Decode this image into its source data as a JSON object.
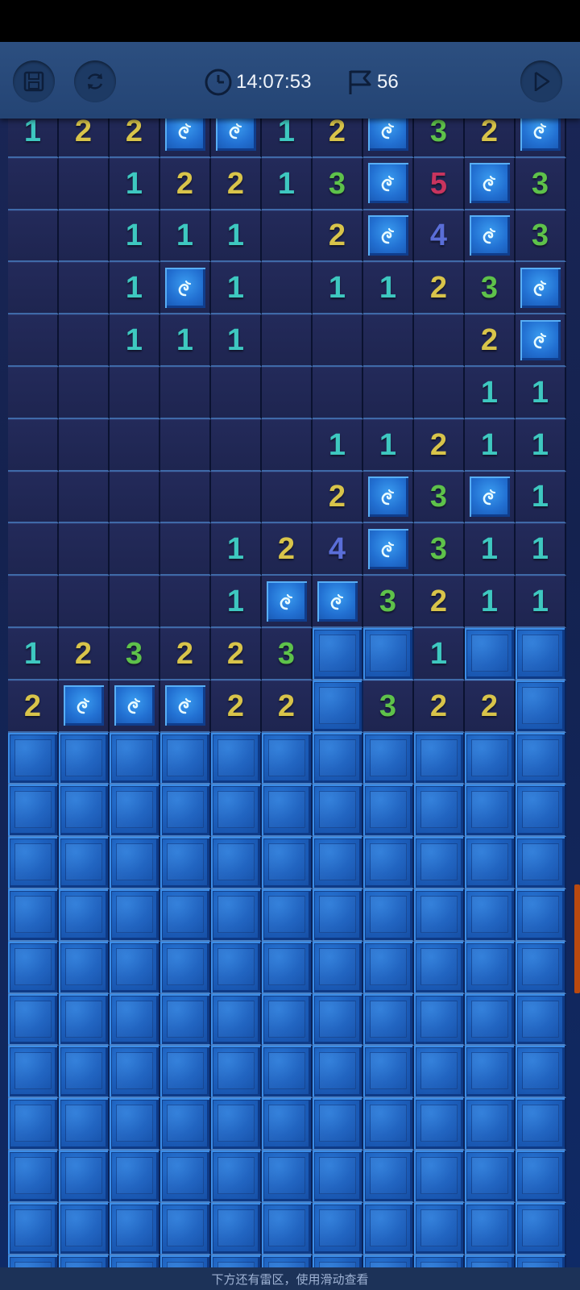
{
  "toolbar": {
    "timer": "14:07:53",
    "flags_remaining": "56"
  },
  "board": {
    "rows": [
      [
        "1",
        "2",
        "2",
        "M",
        "M",
        "1",
        "2",
        "M",
        "3",
        "2",
        "M"
      ],
      [
        "",
        "",
        "1",
        "2",
        "2",
        "1",
        "3",
        "M",
        "5",
        "M",
        "3"
      ],
      [
        "",
        "",
        "1",
        "1",
        "1",
        "",
        "2",
        "M",
        "4",
        "M",
        "3"
      ],
      [
        "",
        "",
        "1",
        "M",
        "1",
        "",
        "1",
        "1",
        "2",
        "3",
        "M"
      ],
      [
        "",
        "",
        "1",
        "1",
        "1",
        "",
        "",
        "",
        "",
        "2",
        "M"
      ],
      [
        "",
        "",
        "",
        "",
        "",
        "",
        "",
        "",
        "",
        "1",
        "1"
      ],
      [
        "",
        "",
        "",
        "",
        "",
        "",
        "1",
        "1",
        "2",
        "1",
        "1"
      ],
      [
        "",
        "",
        "",
        "",
        "",
        "",
        "2",
        "M",
        "3",
        "M",
        "1"
      ],
      [
        "",
        "",
        "",
        "",
        "1",
        "2",
        "4",
        "M",
        "3",
        "1",
        "1"
      ],
      [
        "",
        "",
        "",
        "",
        "1",
        "M",
        "M",
        "3",
        "2",
        "1",
        "1"
      ],
      [
        "1",
        "2",
        "3",
        "2",
        "2",
        "3",
        "C",
        "C",
        "1",
        "C",
        "C"
      ],
      [
        "2",
        "M",
        "M",
        "M",
        "2",
        "2",
        "C",
        "3",
        "2",
        "2",
        "C"
      ],
      [
        "C",
        "C",
        "C",
        "C",
        "C",
        "C",
        "C",
        "C",
        "C",
        "C",
        "C"
      ],
      [
        "C",
        "C",
        "C",
        "C",
        "C",
        "C",
        "C",
        "C",
        "C",
        "C",
        "C"
      ],
      [
        "C",
        "C",
        "C",
        "C",
        "C",
        "C",
        "C",
        "C",
        "C",
        "C",
        "C"
      ],
      [
        "C",
        "C",
        "C",
        "C",
        "C",
        "C",
        "C",
        "C",
        "C",
        "C",
        "C"
      ],
      [
        "C",
        "C",
        "C",
        "C",
        "C",
        "C",
        "C",
        "C",
        "C",
        "C",
        "C"
      ],
      [
        "C",
        "C",
        "C",
        "C",
        "C",
        "C",
        "C",
        "C",
        "C",
        "C",
        "C"
      ],
      [
        "C",
        "C",
        "C",
        "C",
        "C",
        "C",
        "C",
        "C",
        "C",
        "C",
        "C"
      ],
      [
        "C",
        "C",
        "C",
        "C",
        "C",
        "C",
        "C",
        "C",
        "C",
        "C",
        "C"
      ],
      [
        "C",
        "C",
        "C",
        "C",
        "C",
        "C",
        "C",
        "C",
        "C",
        "C",
        "C"
      ],
      [
        "C",
        "C",
        "C",
        "C",
        "C",
        "C",
        "C",
        "C",
        "C",
        "C",
        "C"
      ],
      [
        "C",
        "C",
        "C",
        "C",
        "C",
        "C",
        "C",
        "C",
        "C",
        "C",
        "C"
      ]
    ]
  },
  "footer": {
    "hint": "下方还有雷区，使用滑动查看"
  },
  "icons": {
    "save": "save-icon",
    "restart": "restart-icon",
    "clock": "clock-icon",
    "flag": "flag-icon",
    "play": "play-icon",
    "mine": "swirl-mine-icon"
  },
  "colors": {
    "number_1": "#3ec8c0",
    "number_2": "#d8c44a",
    "number_3": "#5ec24a",
    "number_4": "#5a6ed8",
    "number_5": "#c8345e",
    "closed_tile": "#1c5fbd",
    "open_tile": "#212855",
    "toolbar": "#2c4f80"
  }
}
